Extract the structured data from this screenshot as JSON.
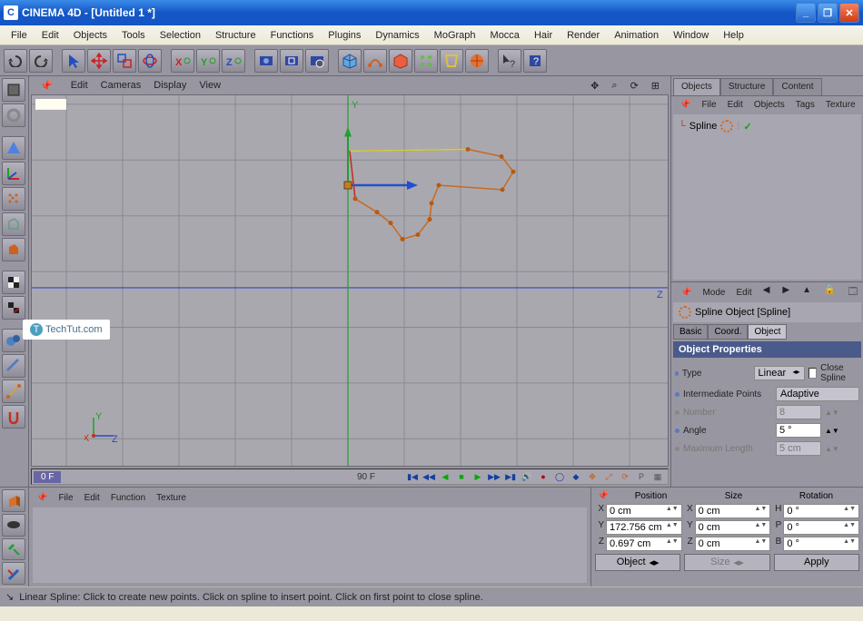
{
  "window": {
    "title": "CINEMA 4D - [Untitled 1 *]"
  },
  "menubar": [
    "File",
    "Edit",
    "Objects",
    "Tools",
    "Selection",
    "Structure",
    "Functions",
    "Plugins",
    "Dynamics",
    "MoGraph",
    "Mocca",
    "Hair",
    "Render",
    "Animation",
    "Window",
    "Help"
  ],
  "viewport_menu": [
    "Edit",
    "Cameras",
    "Display",
    "View"
  ],
  "axis_labels": {
    "x": "X",
    "y": "Y",
    "z": "Z"
  },
  "viewport_axes": {
    "y": "Y",
    "x": "X",
    "z": "Z"
  },
  "viewport_axes_right": {
    "y": "Y",
    "z": "Z"
  },
  "watermark": "TechTut.com",
  "timeline": {
    "current": "0 F",
    "mid": "90 F"
  },
  "right_tabs": [
    "Objects",
    "Structure",
    "Content"
  ],
  "objmgr_menu": [
    "File",
    "Edit",
    "Objects",
    "Tags",
    "Texture"
  ],
  "tree_item": {
    "name": "Spline"
  },
  "attrmgr_menu": [
    "Mode",
    "Edit"
  ],
  "obj_header": "Spline Object [Spline]",
  "attr_tabs": [
    "Basic",
    "Coord.",
    "Object"
  ],
  "prop_header": "Object Properties",
  "props": {
    "type_label": "Type",
    "type_value": "Linear",
    "close_spline_label": "Close Spline",
    "intermediate_label": "Intermediate Points",
    "intermediate_value": "Adaptive",
    "number_label": "Number",
    "number_value": "8",
    "angle_label": "Angle",
    "angle_value": "5 °",
    "maxlen_label": "Maximum Length",
    "maxlen_value": "5 cm"
  },
  "materials_menu": [
    "File",
    "Edit",
    "Function",
    "Texture"
  ],
  "coords": {
    "headers": {
      "position": "Position",
      "size": "Size",
      "rotation": "Rotation"
    },
    "rows": [
      {
        "axis_p": "X",
        "p": "0 cm",
        "axis_s": "X",
        "s": "0 cm",
        "axis_r": "H",
        "r": "0 °"
      },
      {
        "axis_p": "Y",
        "p": "172.756 cm",
        "axis_s": "Y",
        "s": "0 cm",
        "axis_r": "P",
        "r": "0 °"
      },
      {
        "axis_p": "Z",
        "p": "0.697 cm",
        "axis_s": "Z",
        "s": "0 cm",
        "axis_r": "B",
        "r": "0 °"
      }
    ],
    "foot": {
      "object": "Object",
      "size": "Size",
      "apply": "Apply"
    }
  },
  "statusbar": "Linear Spline: Click to create new points. Click on spline to insert point. Click on first point to close spline."
}
